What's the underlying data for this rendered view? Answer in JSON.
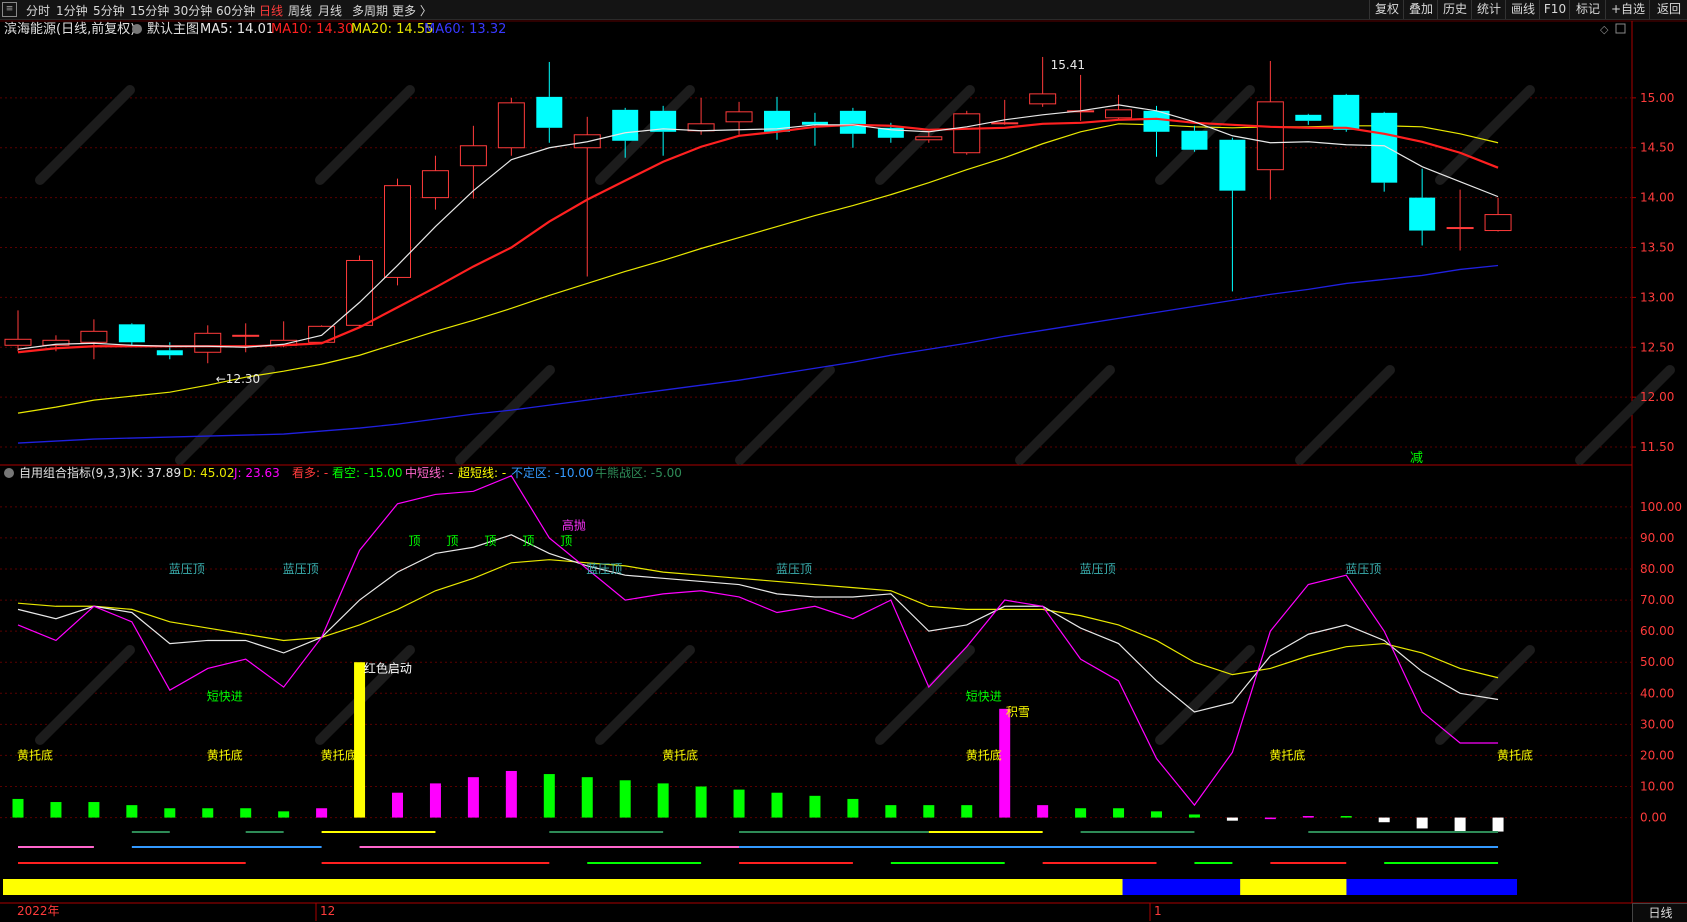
{
  "toolbar": {
    "left_items": [
      "分时",
      "1分钟",
      "5分钟",
      "15分钟",
      "30分钟",
      "60分钟",
      "日线",
      "周线",
      "月线",
      "多周期",
      "更多 〉"
    ],
    "active_item": "日线",
    "right_items": [
      "复权",
      "叠加",
      "历史",
      "统计",
      "画线",
      "F10",
      "标记",
      "+自选",
      "返回"
    ]
  },
  "main_header": {
    "stock": "滨海能源(日线,前复权)",
    "template": "默认主图",
    "ma5": "MA5: 14.01",
    "ma10": "MA10: 14.30",
    "ma20": "MA20: 14.55",
    "ma60": "MA60: 13.32"
  },
  "price_axis": [
    "15.00",
    "14.50",
    "14.00",
    "13.50",
    "13.00",
    "12.50",
    "12.00",
    "11.50"
  ],
  "annotations": {
    "high": "15.41",
    "low": "←12.30",
    "reduce_mark": "减"
  },
  "indicator_header": {
    "name": "自用组合指标(9,3,3)",
    "k": "K: 37.89",
    "d": "D: 45.02",
    "j": "J: 23.63",
    "bull": "看多: -",
    "bear": "看空: -15.00",
    "mid": "中短线: -",
    "ultra": "超短线: -",
    "unstable": "不定区: -10.00",
    "zone": "牛熊战区: -5.00"
  },
  "indicator_axis": [
    "100.00",
    "90.00",
    "80.00",
    "70.00",
    "60.00",
    "50.00",
    "40.00",
    "30.00",
    "20.00",
    "10.00",
    "0.00"
  ],
  "date_axis": [
    "2022年",
    "12",
    "1"
  ],
  "period_tab": "日线",
  "colors": {
    "up": "#ff3b3b",
    "down": "#00ffff",
    "ma5": "#e8e8e8",
    "ma10": "#ff2020",
    "ma20": "#e8e800",
    "ma60": "#2020e0",
    "k": "#e8e8e8",
    "d": "#e8e800",
    "j": "#ff00ff",
    "green_bar": "#00ff00",
    "magenta_bar": "#ff00ff",
    "grid": "#5a0000"
  },
  "chart_data": {
    "type": "candlestick",
    "candles": [
      {
        "o": 12.52,
        "c": 12.58,
        "h": 12.87,
        "l": 12.46
      },
      {
        "o": 12.52,
        "c": 12.57,
        "h": 12.62,
        "l": 12.46
      },
      {
        "o": 12.55,
        "c": 12.66,
        "h": 12.78,
        "l": 12.38
      },
      {
        "o": 12.73,
        "c": 12.55,
        "h": 12.74,
        "l": 12.52
      },
      {
        "o": 12.47,
        "c": 12.42,
        "h": 12.55,
        "l": 12.38
      },
      {
        "o": 12.45,
        "c": 12.64,
        "h": 12.72,
        "l": 12.34
      },
      {
        "o": 12.62,
        "c": 12.62,
        "h": 12.74,
        "l": 12.45
      },
      {
        "o": 12.52,
        "c": 12.57,
        "h": 12.76,
        "l": 12.5
      },
      {
        "o": 12.55,
        "c": 12.71,
        "h": 12.72,
        "l": 12.53
      },
      {
        "o": 12.72,
        "c": 13.37,
        "h": 13.42,
        "l": 12.7
      },
      {
        "o": 13.2,
        "c": 14.12,
        "h": 14.19,
        "l": 13.12
      },
      {
        "o": 14.0,
        "c": 14.27,
        "h": 14.42,
        "l": 13.88
      },
      {
        "o": 14.32,
        "c": 14.52,
        "h": 14.72,
        "l": 13.99
      },
      {
        "o": 14.5,
        "c": 14.95,
        "h": 15.0,
        "l": 14.42
      },
      {
        "o": 15.01,
        "c": 14.7,
        "h": 15.36,
        "l": 14.55
      },
      {
        "o": 14.5,
        "c": 14.63,
        "h": 14.81,
        "l": 13.21
      },
      {
        "o": 14.88,
        "c": 14.57,
        "h": 14.9,
        "l": 14.4
      },
      {
        "o": 14.87,
        "c": 14.66,
        "h": 14.92,
        "l": 14.42
      },
      {
        "o": 14.67,
        "c": 14.74,
        "h": 15.0,
        "l": 14.63
      },
      {
        "o": 14.76,
        "c": 14.86,
        "h": 14.96,
        "l": 14.63
      },
      {
        "o": 14.87,
        "c": 14.66,
        "h": 15.01,
        "l": 14.58
      },
      {
        "o": 14.76,
        "c": 14.73,
        "h": 14.85,
        "l": 14.52
      },
      {
        "o": 14.87,
        "c": 14.64,
        "h": 14.9,
        "l": 14.5
      },
      {
        "o": 14.7,
        "c": 14.6,
        "h": 14.75,
        "l": 14.55
      },
      {
        "o": 14.58,
        "c": 14.61,
        "h": 14.66,
        "l": 14.55
      },
      {
        "o": 14.45,
        "c": 14.84,
        "h": 14.87,
        "l": 14.43
      },
      {
        "o": 14.75,
        "c": 14.75,
        "h": 14.98,
        "l": 14.73
      },
      {
        "o": 14.94,
        "c": 15.04,
        "h": 15.41,
        "l": 14.91
      },
      {
        "o": 14.87,
        "c": 14.87,
        "h": 15.23,
        "l": 14.77
      },
      {
        "o": 14.8,
        "c": 14.88,
        "h": 15.03,
        "l": 14.78
      },
      {
        "o": 14.87,
        "c": 14.66,
        "h": 14.92,
        "l": 14.41
      },
      {
        "o": 14.67,
        "c": 14.48,
        "h": 14.72,
        "l": 14.46
      },
      {
        "o": 14.58,
        "c": 14.07,
        "h": 14.6,
        "l": 13.06
      },
      {
        "o": 14.28,
        "c": 14.96,
        "h": 15.37,
        "l": 13.98
      },
      {
        "o": 14.83,
        "c": 14.77,
        "h": 14.84,
        "l": 14.73
      },
      {
        "o": 15.03,
        "c": 14.68,
        "h": 15.04,
        "l": 14.66
      },
      {
        "o": 14.85,
        "c": 14.15,
        "h": 14.86,
        "l": 14.06
      },
      {
        "o": 14.0,
        "c": 13.67,
        "h": 14.29,
        "l": 13.52
      },
      {
        "o": 13.7,
        "c": 13.7,
        "h": 14.08,
        "l": 13.47
      },
      {
        "o": 13.67,
        "c": 13.83,
        "h": 14.0,
        "l": 13.66
      }
    ],
    "ma5": [
      12.48,
      12.53,
      12.54,
      12.52,
      12.51,
      12.51,
      12.5,
      12.53,
      12.62,
      12.95,
      13.32,
      13.71,
      14.07,
      14.38,
      14.5,
      14.56,
      14.65,
      14.69,
      14.67,
      14.68,
      14.69,
      14.73,
      14.73,
      14.68,
      14.66,
      14.71,
      14.78,
      14.83,
      14.87,
      14.93,
      14.87,
      14.76,
      14.62,
      14.55,
      14.56,
      14.53,
      14.52,
      14.31,
      14.16,
      14.01
    ],
    "ma10": [
      12.45,
      12.49,
      12.51,
      12.51,
      12.51,
      12.51,
      12.51,
      12.52,
      12.54,
      12.7,
      12.9,
      13.1,
      13.31,
      13.5,
      13.76,
      13.98,
      14.17,
      14.36,
      14.51,
      14.62,
      14.66,
      14.71,
      14.73,
      14.72,
      14.68,
      14.69,
      14.7,
      14.74,
      14.75,
      14.78,
      14.79,
      14.75,
      14.73,
      14.71,
      14.7,
      14.7,
      14.64,
      14.56,
      14.45,
      14.3
    ],
    "ma20": [
      11.84,
      11.9,
      11.97,
      12.01,
      12.05,
      12.12,
      12.2,
      12.26,
      12.33,
      12.42,
      12.54,
      12.66,
      12.77,
      12.89,
      13.02,
      13.14,
      13.26,
      13.37,
      13.49,
      13.6,
      13.71,
      13.82,
      13.92,
      14.03,
      14.15,
      14.28,
      14.4,
      14.54,
      14.66,
      14.74,
      14.73,
      14.71,
      14.7,
      14.71,
      14.71,
      14.72,
      14.72,
      14.71,
      14.64,
      14.55
    ],
    "ma60": [
      11.54,
      11.56,
      11.58,
      11.59,
      11.6,
      11.61,
      11.62,
      11.63,
      11.66,
      11.69,
      11.73,
      11.78,
      11.83,
      11.87,
      11.92,
      11.97,
      12.02,
      12.07,
      12.12,
      12.17,
      12.23,
      12.29,
      12.35,
      12.42,
      12.48,
      12.54,
      12.61,
      12.67,
      12.73,
      12.79,
      12.85,
      12.91,
      12.97,
      13.03,
      13.08,
      13.14,
      13.18,
      13.22,
      13.28,
      13.32
    ],
    "kdj_k": [
      67,
      64,
      68,
      66,
      56,
      57,
      57,
      53,
      58,
      70,
      79,
      85,
      87,
      91,
      85,
      81,
      78,
      77,
      76,
      75,
      72,
      71,
      71,
      72,
      60,
      62,
      68,
      68,
      61,
      56,
      44,
      34,
      37,
      52,
      59,
      62,
      57,
      47,
      40,
      38
    ],
    "kdj_d": [
      69,
      68,
      68,
      67,
      63,
      61,
      59,
      57,
      58,
      62,
      67,
      73,
      77,
      82,
      83,
      82,
      81,
      79,
      78,
      77,
      76,
      75,
      74,
      73,
      68,
      67,
      67,
      67,
      65,
      62,
      57,
      50,
      46,
      48,
      52,
      55,
      56,
      53,
      48,
      45
    ],
    "kdj_j": [
      62,
      57,
      68,
      63,
      41,
      48,
      51,
      42,
      58,
      86,
      101,
      104,
      105,
      110,
      90,
      80,
      70,
      72,
      73,
      71,
      66,
      68,
      64,
      70,
      42,
      55,
      70,
      68,
      51,
      44,
      19,
      4,
      21,
      60,
      75,
      78,
      60,
      34,
      24,
      24
    ],
    "bars": [
      {
        "v": 6,
        "c": "green"
      },
      {
        "v": 5,
        "c": "green"
      },
      {
        "v": 5,
        "c": "green"
      },
      {
        "v": 4,
        "c": "green"
      },
      {
        "v": 3,
        "c": "green"
      },
      {
        "v": 3,
        "c": "green"
      },
      {
        "v": 3,
        "c": "green"
      },
      {
        "v": 2,
        "c": "green"
      },
      {
        "v": 3,
        "c": "magenta"
      },
      {
        "v": 50,
        "c": "yellow"
      },
      {
        "v": 8,
        "c": "magenta"
      },
      {
        "v": 11,
        "c": "magenta"
      },
      {
        "v": 13,
        "c": "magenta"
      },
      {
        "v": 15,
        "c": "magenta"
      },
      {
        "v": 14,
        "c": "green"
      },
      {
        "v": 13,
        "c": "green"
      },
      {
        "v": 12,
        "c": "green"
      },
      {
        "v": 11,
        "c": "green"
      },
      {
        "v": 10,
        "c": "green"
      },
      {
        "v": 9,
        "c": "green"
      },
      {
        "v": 8,
        "c": "green"
      },
      {
        "v": 7,
        "c": "green"
      },
      {
        "v": 6,
        "c": "green"
      },
      {
        "v": 4,
        "c": "green"
      },
      {
        "v": 4,
        "c": "green"
      },
      {
        "v": 4,
        "c": "green"
      },
      {
        "v": 35,
        "c": "magenta"
      },
      {
        "v": 4,
        "c": "magenta"
      },
      {
        "v": 3,
        "c": "green"
      },
      {
        "v": 3,
        "c": "green"
      },
      {
        "v": 2,
        "c": "green"
      },
      {
        "v": 1,
        "c": "green"
      },
      {
        "v": -1,
        "c": "white"
      },
      {
        "v": -0.5,
        "c": "magenta"
      },
      {
        "v": 0.5,
        "c": "magenta"
      },
      {
        "v": 0.5,
        "c": "green"
      },
      {
        "v": -1.5,
        "c": "white"
      },
      {
        "v": -3.5,
        "c": "white"
      },
      {
        "v": -4.5,
        "c": "white"
      },
      {
        "v": -4.5,
        "c": "white"
      }
    ],
    "signal_labels": [
      {
        "text": "蓝压顶",
        "i": 4.5,
        "v": 80,
        "color": "#3ab0b0"
      },
      {
        "text": "蓝压顶",
        "i": 7.5,
        "v": 80,
        "color": "#3ab0b0"
      },
      {
        "text": "蓝压顶",
        "i": 15.5,
        "v": 80,
        "color": "#3ab0b0"
      },
      {
        "text": "蓝压顶",
        "i": 20.5,
        "v": 80,
        "color": "#3ab0b0"
      },
      {
        "text": "蓝压顶",
        "i": 28.5,
        "v": 80,
        "color": "#3ab0b0"
      },
      {
        "text": "蓝压顶",
        "i": 35.5,
        "v": 80,
        "color": "#3ab0b0"
      },
      {
        "text": "顶",
        "i": 10.5,
        "v": 89,
        "color": "#00ff00"
      },
      {
        "text": "顶",
        "i": 11.5,
        "v": 89,
        "color": "#00ff00"
      },
      {
        "text": "顶",
        "i": 12.5,
        "v": 89,
        "color": "#00ff00"
      },
      {
        "text": "顶",
        "i": 13.5,
        "v": 89,
        "color": "#00ff00"
      },
      {
        "text": "顶",
        "i": 14.5,
        "v": 89,
        "color": "#00ff00"
      },
      {
        "text": "高抛",
        "i": 14.7,
        "v": 94,
        "color": "#ff33ff"
      },
      {
        "text": "短快进",
        "i": 5.5,
        "v": 39,
        "color": "#00ff00"
      },
      {
        "text": "短快进",
        "i": 25.5,
        "v": 39,
        "color": "#00ff00"
      },
      {
        "text": "红色启动",
        "i": 9.8,
        "v": 48,
        "color": "#ffffff"
      },
      {
        "text": "积雪",
        "i": 26.4,
        "v": 34,
        "color": "#ffff00"
      },
      {
        "text": "黄托底",
        "i": 0.5,
        "v": 20,
        "color": "#ffff00"
      },
      {
        "text": "黄托底",
        "i": 5.5,
        "v": 20,
        "color": "#ffff00"
      },
      {
        "text": "黄托底",
        "i": 8.5,
        "v": 20,
        "color": "#ffff00"
      },
      {
        "text": "黄托底",
        "i": 17.5,
        "v": 20,
        "color": "#ffff00"
      },
      {
        "text": "黄托底",
        "i": 25.5,
        "v": 20,
        "color": "#ffff00"
      },
      {
        "text": "黄托底",
        "i": 33.5,
        "v": 20,
        "color": "#ffff00"
      },
      {
        "text": "黄托底",
        "i": 39.5,
        "v": 20,
        "color": "#ffff00"
      }
    ],
    "signal_lines": [
      {
        "row": 0,
        "from": 3,
        "to": 4,
        "color": "#2e8b57"
      },
      {
        "row": 0,
        "from": 6,
        "to": 7,
        "color": "#2e8b57"
      },
      {
        "row": 0,
        "from": 8,
        "to": 11,
        "color": "#ffff00"
      },
      {
        "row": 0,
        "from": 14,
        "to": 17,
        "color": "#2e8b57"
      },
      {
        "row": 0,
        "from": 19,
        "to": 24,
        "color": "#2e8b57"
      },
      {
        "row": 0,
        "from": 24,
        "to": 27,
        "color": "#ffff00"
      },
      {
        "row": 0,
        "from": 28,
        "to": 31,
        "color": "#2e8b57"
      },
      {
        "row": 0,
        "from": 34,
        "to": 39,
        "color": "#2e8b57"
      },
      {
        "row": 1,
        "from": 0,
        "to": 2,
        "color": "#ff66cc"
      },
      {
        "row": 1,
        "from": 3,
        "to": 8,
        "color": "#3399ff"
      },
      {
        "row": 1,
        "from": 9,
        "to": 19,
        "color": "#ff66cc"
      },
      {
        "row": 1,
        "from": 19,
        "to": 39,
        "color": "#3399ff"
      },
      {
        "row": 2,
        "from": 0,
        "to": 6,
        "color": "#ff2020"
      },
      {
        "row": 2,
        "from": 8,
        "to": 14,
        "color": "#ff2020"
      },
      {
        "row": 2,
        "from": 15,
        "to": 18,
        "color": "#00ff00"
      },
      {
        "row": 2,
        "from": 19,
        "to": 22,
        "color": "#ff2020"
      },
      {
        "row": 2,
        "from": 23,
        "to": 26,
        "color": "#00ff00"
      },
      {
        "row": 2,
        "from": 27,
        "to": 30,
        "color": "#ff2020"
      },
      {
        "row": 2,
        "from": 31,
        "to": 32,
        "color": "#00ff00"
      },
      {
        "row": 2,
        "from": 33,
        "to": 35,
        "color": "#ff2020"
      },
      {
        "row": 2,
        "from": 36,
        "to": 39,
        "color": "#00ff00"
      }
    ],
    "trend_band": [
      {
        "from": 0,
        "to": 29.5,
        "color": "#ffff00"
      },
      {
        "from": 29.5,
        "to": 32.6,
        "color": "#0000ff"
      },
      {
        "from": 32.6,
        "to": 35.4,
        "color": "#ffff00"
      },
      {
        "from": 35.4,
        "to": 39.5,
        "color": "#0000ff"
      }
    ],
    "price_ylim": [
      11.35,
      15.58
    ],
    "indicator_ylim": [
      -4,
      108
    ]
  }
}
